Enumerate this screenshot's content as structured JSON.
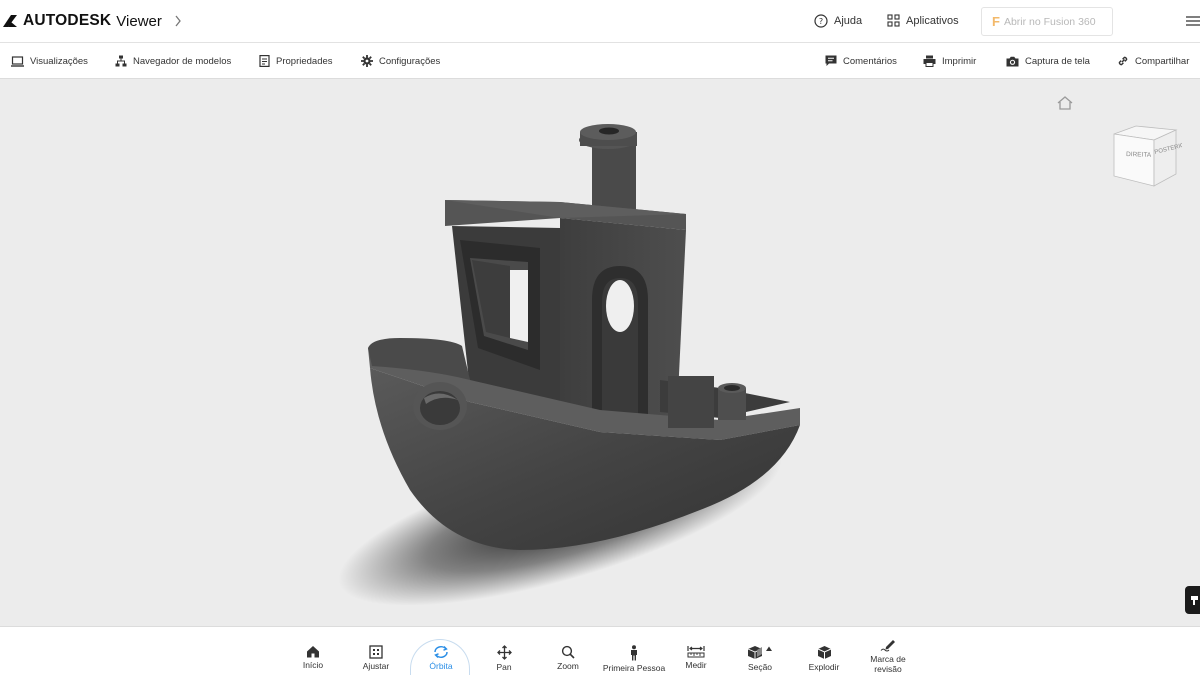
{
  "app": {
    "brand_name": "AUTODESK",
    "product_name": "Viewer"
  },
  "header": {
    "help_label": "Ajuda",
    "apps_label": "Aplicativos",
    "fusion_label": "Abrir no Fusion 360"
  },
  "toolbar": {
    "left": [
      {
        "label": "Visualizações",
        "icon": "laptop-icon"
      },
      {
        "label": "Navegador de modelos",
        "icon": "hierarchy-icon"
      },
      {
        "label": "Propriedades",
        "icon": "document-icon"
      },
      {
        "label": "Configurações",
        "icon": "gear-icon"
      }
    ],
    "right": [
      {
        "label": "Comentários",
        "icon": "comment-icon"
      },
      {
        "label": "Imprimir",
        "icon": "printer-icon"
      },
      {
        "label": "Captura de tela",
        "icon": "camera-icon"
      },
      {
        "label": "Compartilhar",
        "icon": "link-icon"
      }
    ]
  },
  "viewcube": {
    "face_right": "DIREITA",
    "face_back": "POSTERIOR"
  },
  "bottom_tools": [
    {
      "label": "Início",
      "icon": "home-icon",
      "active": false
    },
    {
      "label": "Ajustar",
      "icon": "fit-icon",
      "active": false
    },
    {
      "label": "Órbita",
      "icon": "orbit-icon",
      "active": true
    },
    {
      "label": "Pan",
      "icon": "pan-icon",
      "active": false
    },
    {
      "label": "Zoom",
      "icon": "zoom-icon",
      "active": false
    },
    {
      "label": "Primeira Pessoa",
      "icon": "person-icon",
      "active": false
    },
    {
      "label": "Medir",
      "icon": "measure-icon",
      "active": false
    },
    {
      "label": "Seção",
      "icon": "section-icon",
      "active": false
    },
    {
      "label": "Explodir",
      "icon": "explode-icon",
      "active": false
    },
    {
      "label": "Marca de revisão",
      "icon": "markup-icon",
      "active": false
    }
  ],
  "colors": {
    "accent": "#2a8ee6",
    "viewport_bg": "#ececec",
    "model": "#4a4a4a"
  }
}
